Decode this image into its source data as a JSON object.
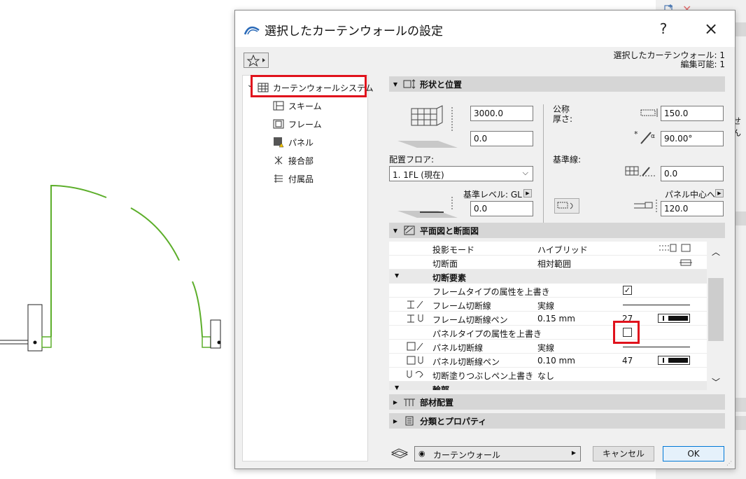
{
  "dialog": {
    "title": "選択したカーテンウォールの設定",
    "help": "?",
    "close": "×",
    "selection_info_line1": "選択したカーテンウォール: 1",
    "selection_info_line2": "編集可能: 1"
  },
  "tree": {
    "root": "カーテンウォールシステム",
    "items": [
      "スキーム",
      "フレーム",
      "パネル",
      "接合部",
      "付属品"
    ]
  },
  "shape_section": {
    "title": "形状と位置",
    "height_value": "3000.0",
    "offset_value": "0.0",
    "floor_label": "配置フロア:",
    "floor_value": "1. 1FL (現在)",
    "ref_level_label": "基準レベル: GL",
    "ref_level_value": "0.0",
    "nominal_label": "公称",
    "thickness_label": "厚さ:",
    "thickness_value": "150.0",
    "angle_value": "90.00°",
    "baseline_label": "基準線:",
    "baseline_value": "0.0",
    "panel_center_label": "パネル中心へ",
    "panel_center_value": "120.0"
  },
  "plan_section": {
    "title": "平面図と断面図",
    "rows": [
      {
        "label": "投影モード",
        "value": "ハイブリッド",
        "extra": ""
      },
      {
        "label": "切断面",
        "value": "相対範囲",
        "extra": ""
      },
      {
        "label": "切断要素",
        "value": "",
        "extra": ""
      },
      {
        "label": "フレームタイプの属性を上書き",
        "value": "",
        "extra": ""
      },
      {
        "label": "フレーム切断線",
        "value": "実線",
        "extra": ""
      },
      {
        "label": "フレーム切断線ペン",
        "value": "0.15 mm",
        "extra": "27"
      },
      {
        "label": "パネルタイプの属性を上書き",
        "value": "",
        "extra": ""
      },
      {
        "label": "パネル切断線",
        "value": "実線",
        "extra": ""
      },
      {
        "label": "パネル切断線ペン",
        "value": "0.10 mm",
        "extra": "47"
      },
      {
        "label": "切断塗りつぶしペン上書き",
        "value": "なし",
        "extra": ""
      },
      {
        "label": "輪郭",
        "value": "",
        "extra": ""
      }
    ]
  },
  "sections": {
    "member": "部材配置",
    "classification": "分類とプロパティ"
  },
  "bottom": {
    "layer": "カーテンウォール",
    "cancel": "キャンセル",
    "ok": "OK"
  },
  "right_strip": {
    "text": "せん"
  },
  "colors": {
    "highlight_red": "#e0121c",
    "drawing_green": "#5cae2a",
    "ok_border": "#0078d7"
  }
}
